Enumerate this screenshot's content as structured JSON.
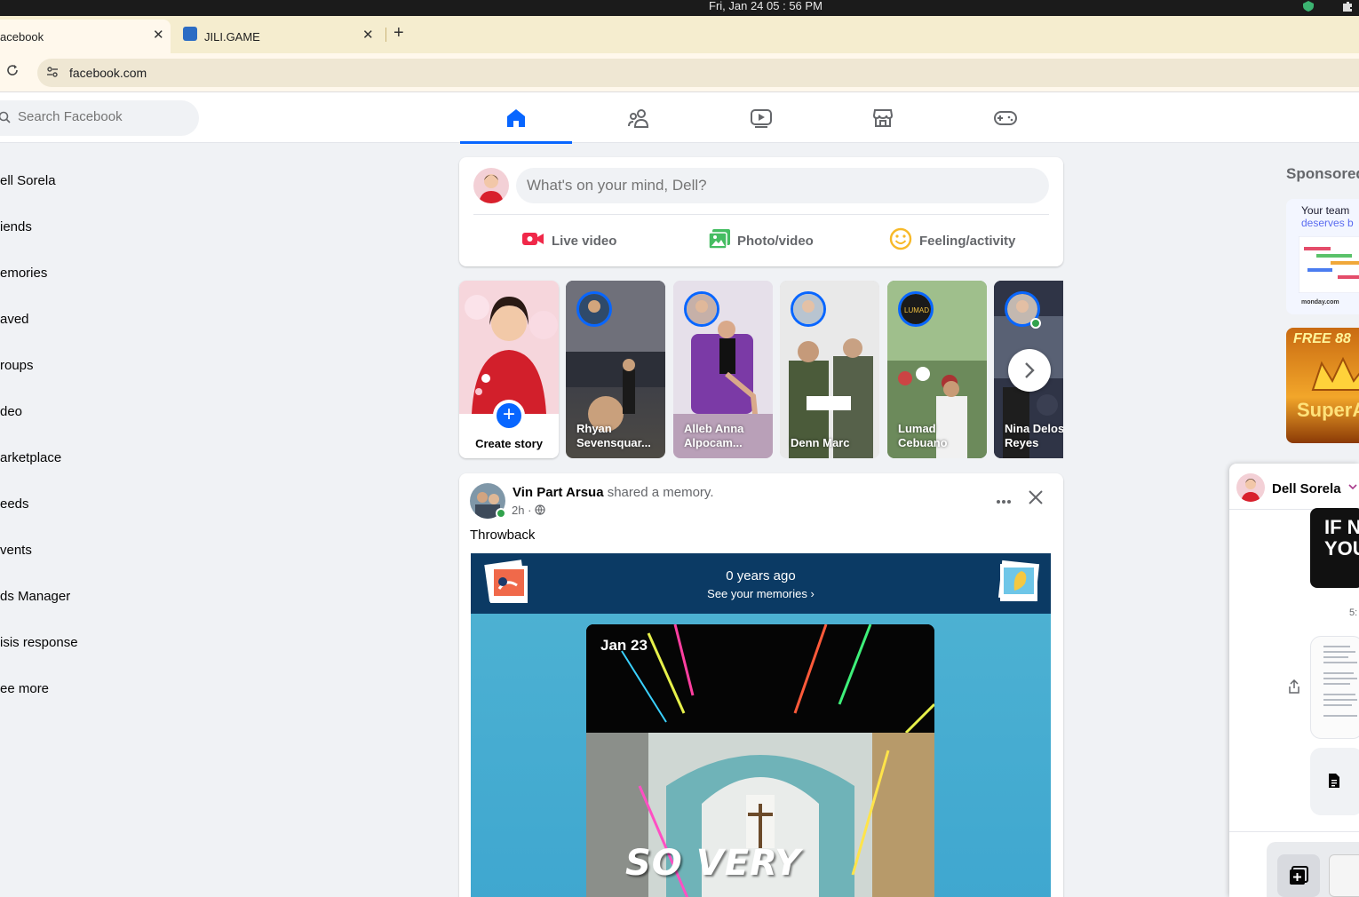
{
  "os": {
    "clock": "Fri, Jan 24  05 : 56 PM"
  },
  "browser": {
    "tabs": [
      {
        "label": "acebook",
        "active": true
      },
      {
        "label": "JILI.GAME",
        "active": false
      }
    ],
    "close_glyph": "✕",
    "new_tab_glyph": "+",
    "url": "facebook.com"
  },
  "header": {
    "search_placeholder": "Search Facebook",
    "nav": [
      "home-icon",
      "friends-icon",
      "video-icon",
      "marketplace-icon",
      "gaming-icon"
    ],
    "accent": "#0866ff"
  },
  "left_nav": {
    "items": [
      "ell Sorela",
      "iends",
      "emories",
      "aved",
      "roups",
      "deo",
      "arketplace",
      "eeds",
      "vents",
      "ds Manager",
      "isis response",
      "ee more"
    ]
  },
  "composer": {
    "placeholder": "What's on your mind, Dell?",
    "actions": [
      {
        "label": "Live video",
        "icon": "live-video-icon",
        "color": "#f02849"
      },
      {
        "label": "Photo/video",
        "icon": "photo-icon",
        "color": "#45bd62"
      },
      {
        "label": "Feeling/activity",
        "icon": "feeling-icon",
        "color": "#f7b928"
      }
    ]
  },
  "stories": {
    "create_label": "Create story",
    "items": [
      {
        "name": "Rhyan Sevensquar..."
      },
      {
        "name": "Alleb Anna Alpocam..."
      },
      {
        "name": "Denn Marc"
      },
      {
        "name": "Lumad Cebuano"
      },
      {
        "name": "Nina Delos Reyes"
      }
    ]
  },
  "post": {
    "author": "Vin Part Arsua",
    "action": " shared a memory.",
    "time": "2h",
    "meta_sep": " · ",
    "text": "Throwback",
    "memory": {
      "years": "0 years ago",
      "link": "See your memories",
      "date": "Jan 23",
      "overlay": "SO VERY"
    }
  },
  "right": {
    "sponsored": "Sponsored",
    "ad1_line1": "Your team",
    "ad1_line2": "deserves b",
    "ad1_brand": "monday.com",
    "ad2_line1": "FREE 88",
    "ad2_line2": "SuperA"
  },
  "chat": {
    "name": "Dell Sorela",
    "bubble_text": "IF N\nYOU",
    "time": "5:"
  }
}
